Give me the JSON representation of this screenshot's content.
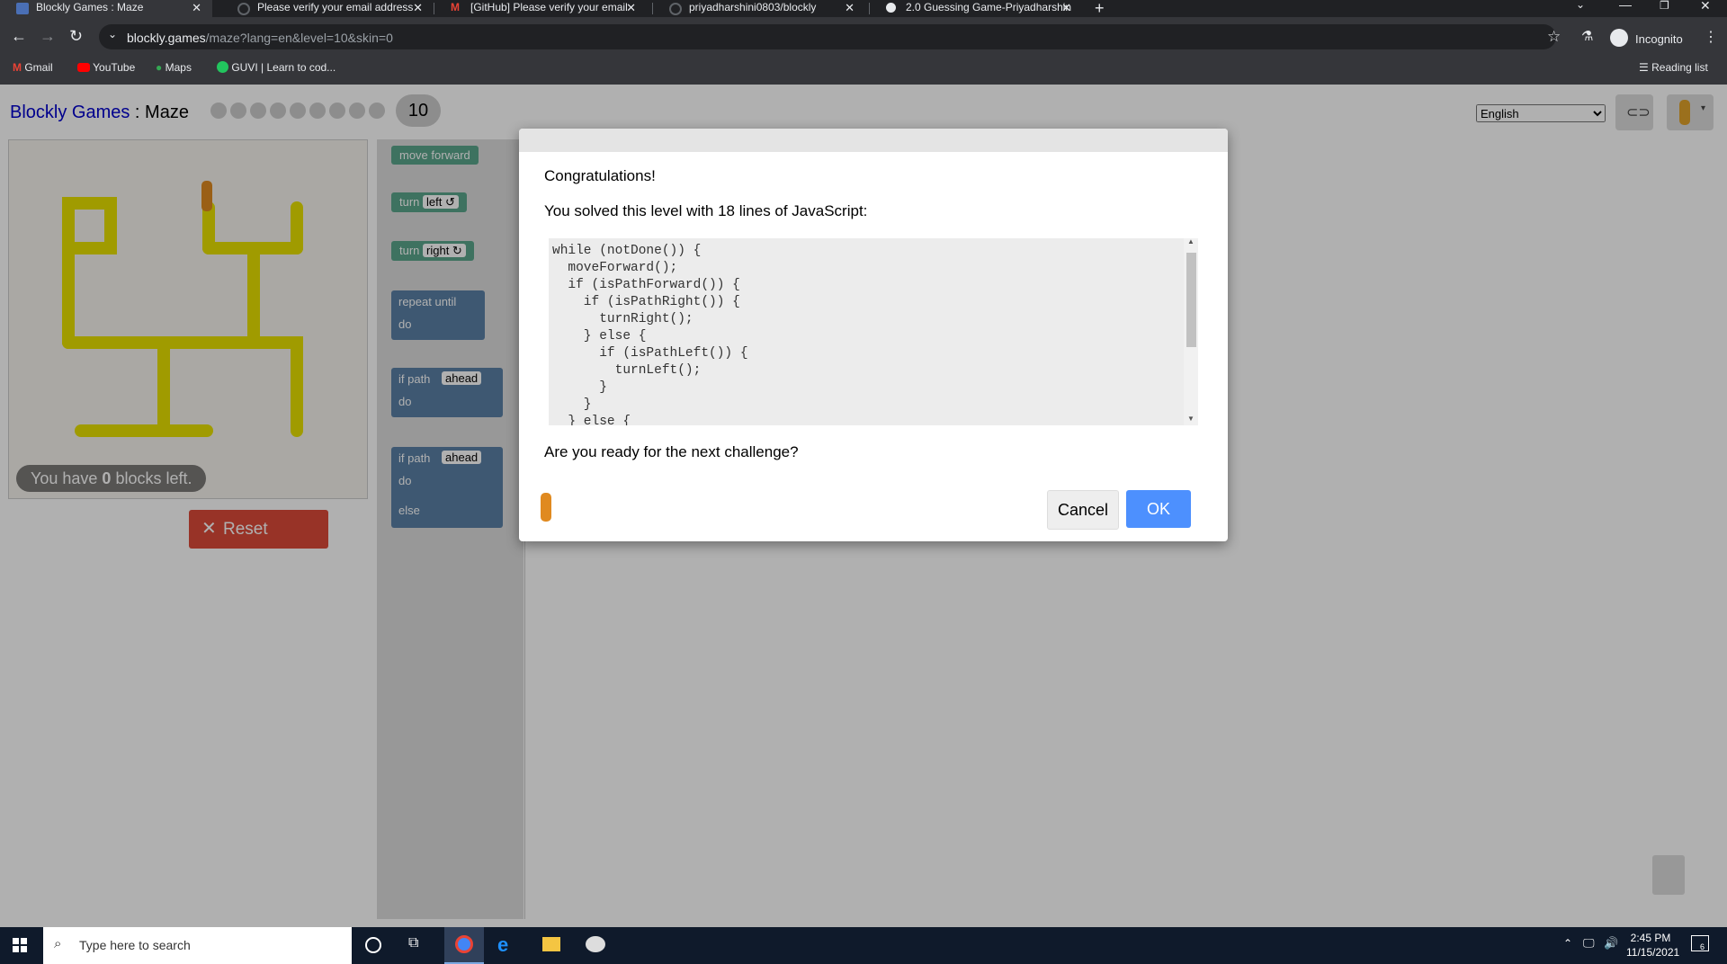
{
  "browser": {
    "tabs": [
      {
        "title": "Blockly Games : Maze",
        "active": true
      },
      {
        "title": "Please verify your email address",
        "active": false
      },
      {
        "title": "[GitHub] Please verify your email",
        "active": false
      },
      {
        "title": "priyadharshini0803/blockly",
        "active": false
      },
      {
        "title": "2.0 Guessing Game-Priyadharshin",
        "active": false
      }
    ],
    "url_host": "blockly.games",
    "url_path": "/maze?lang=en&level=10&skin=0",
    "profile_label": "Incognito",
    "reading_list": "Reading list",
    "bookmarks": [
      "Gmail",
      "YouTube",
      "Maps",
      "GUVI | Learn to cod..."
    ]
  },
  "app": {
    "title_link": "Blockly Games",
    "title_sep": " : ",
    "title_page": "Maze",
    "level": "10",
    "language": "English",
    "blocks_left_prefix": "You have ",
    "blocks_left_count": "0",
    "blocks_left_suffix": " blocks left.",
    "reset_label": "Reset",
    "toolbox": {
      "move_forward": "move forward",
      "turn": "turn",
      "left": "left ↺",
      "right": "right ↻",
      "repeat_until": "repeat until",
      "do": "do",
      "if_path": "if path",
      "ahead": "ahead",
      "else": "else"
    }
  },
  "dialog": {
    "congrats": "Congratulations!",
    "solved": "You solved this level with 18 lines of JavaScript:",
    "code_lines": [
      "while (notDone()) {",
      "  moveForward();",
      "  if (isPathForward()) {",
      "    if (isPathRight()) {",
      "      turnRight();",
      "    } else {",
      "      if (isPathLeft()) {",
      "        turnLeft();",
      "      }",
      "    }",
      "  } else {"
    ],
    "question": "Are you ready for the next challenge?",
    "cancel": "Cancel",
    "ok": "OK"
  },
  "taskbar": {
    "search_placeholder": "Type here to search",
    "time": "2:45 PM",
    "date": "11/15/2021",
    "notif_count": "6"
  },
  "colors": {
    "blockly_blue": "#0000cc",
    "reset_red": "#dd4b39",
    "ok_blue": "#4d90fe",
    "path_yellow": "#e8e100"
  }
}
